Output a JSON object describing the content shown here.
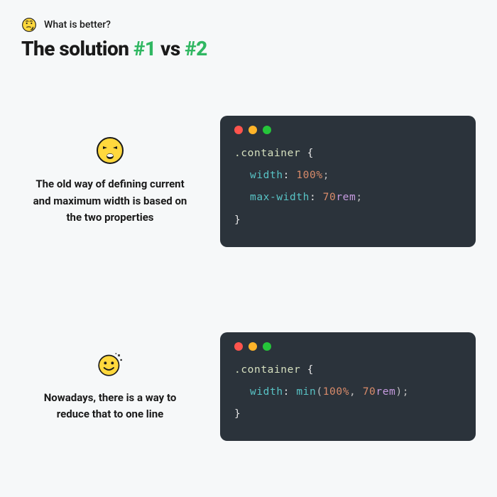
{
  "header": {
    "icon": "thinking-face-icon",
    "subtitle": "What is better?",
    "title_prefix": "The solution ",
    "title_hash1": "#1",
    "title_vs": " vs ",
    "title_hash2": "#2"
  },
  "sections": [
    {
      "emotion": "frustrated",
      "description": "The old way of defining current and maximum width is based on the two properties",
      "code": {
        "selector": ".container",
        "lines": [
          {
            "prop": "width",
            "value_num": "100",
            "value_unit": "%"
          },
          {
            "prop": "max-width",
            "value_num": "70",
            "value_unit": "rem"
          }
        ]
      }
    },
    {
      "emotion": "happy",
      "description": "Nowadays, there is a way to reduce that to one line",
      "code": {
        "selector": ".container",
        "lines": [
          {
            "prop": "width",
            "func": "min",
            "args": [
              {
                "num": "100",
                "unit": "%"
              },
              {
                "num": "70",
                "unit": "rem"
              }
            ]
          }
        ]
      }
    }
  ]
}
